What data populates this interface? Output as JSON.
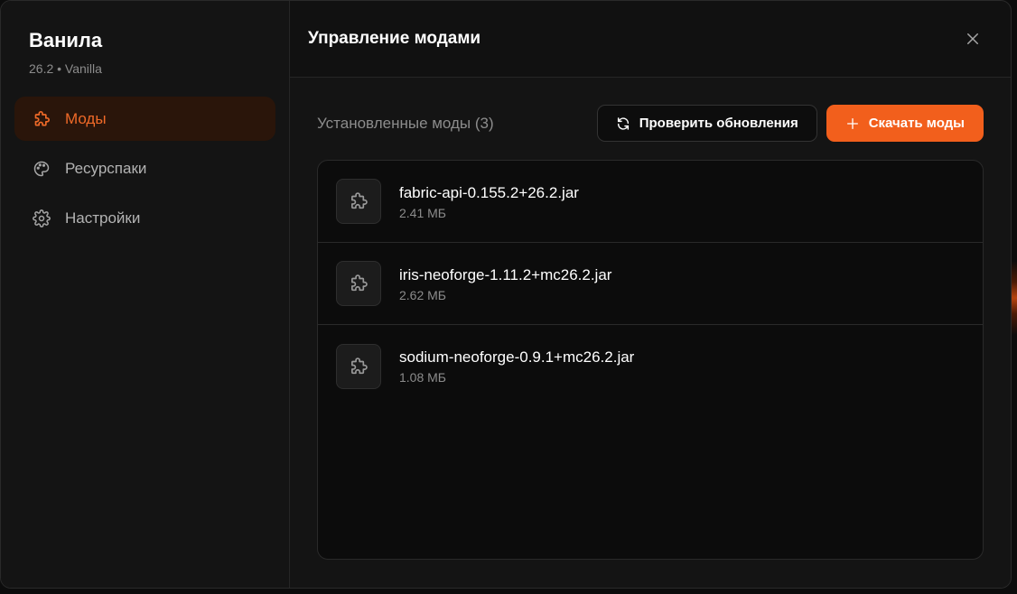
{
  "sidebar": {
    "title": "Ванила",
    "subtitle": "26.2 • Vanilla",
    "items": [
      {
        "label": "Моды",
        "icon": "puzzle-icon",
        "active": true
      },
      {
        "label": "Ресурспаки",
        "icon": "palette-icon",
        "active": false
      },
      {
        "label": "Настройки",
        "icon": "gear-icon",
        "active": false
      }
    ]
  },
  "header": {
    "title": "Управление модами",
    "close_icon": "close-icon"
  },
  "toolbar": {
    "section_title": "Установленные моды (3)",
    "check_updates_label": "Проверить обновления",
    "check_updates_icon": "refresh-icon",
    "download_label": "Скачать моды",
    "download_icon": "plus-icon"
  },
  "mods": [
    {
      "name": "fabric-api-0.155.2+26.2.jar",
      "size": "2.41 МБ",
      "icon": "puzzle-icon"
    },
    {
      "name": "iris-neoforge-1.11.2+mc26.2.jar",
      "size": "2.62 МБ",
      "icon": "puzzle-icon"
    },
    {
      "name": "sodium-neoforge-0.9.1+mc26.2.jar",
      "size": "1.08 МБ",
      "icon": "puzzle-icon"
    }
  ],
  "colors": {
    "accent": "#f25f1c",
    "active_bg": "#2a150a",
    "background": "#111111"
  }
}
